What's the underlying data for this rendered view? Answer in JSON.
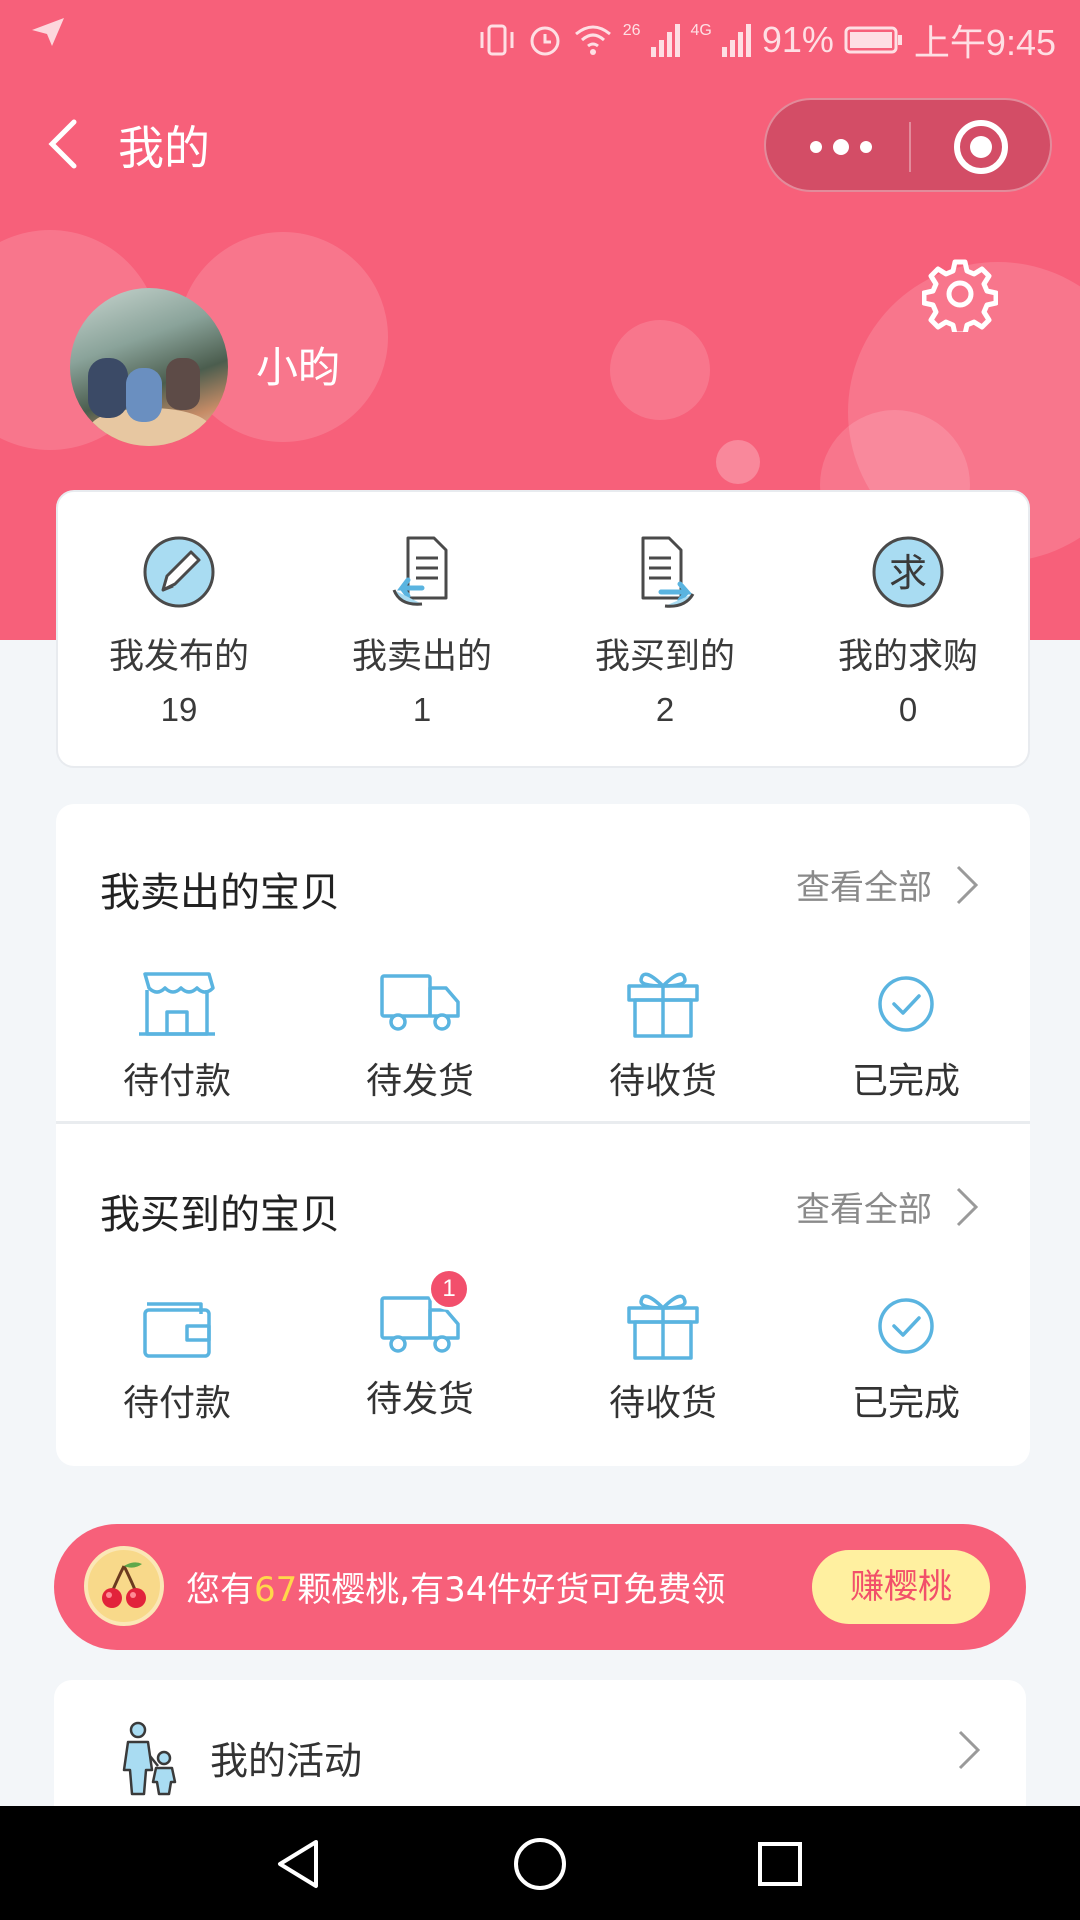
{
  "status_bar": {
    "battery": "91%",
    "time": "上午9:45",
    "net1": "26",
    "net2": "4G"
  },
  "nav": {
    "title": "我的"
  },
  "profile": {
    "username": "小昀"
  },
  "stats": [
    {
      "label": "我发布的",
      "value": "19",
      "icon": "pencil-icon"
    },
    {
      "label": "我卖出的",
      "value": "1",
      "icon": "document-return-icon"
    },
    {
      "label": "我买到的",
      "value": "2",
      "icon": "document-forward-icon"
    },
    {
      "label": "我的求购",
      "value": "0",
      "icon": "qiu-badge-icon",
      "icon_text": "求"
    }
  ],
  "sold": {
    "title": "我卖出的宝贝",
    "view_all": "查看全部",
    "items": [
      {
        "label": "待付款",
        "icon": "storefront-icon"
      },
      {
        "label": "待发货",
        "icon": "truck-icon"
      },
      {
        "label": "待收货",
        "icon": "gift-icon"
      },
      {
        "label": "已完成",
        "icon": "check-circle-icon"
      }
    ]
  },
  "bought": {
    "title": "我买到的宝贝",
    "view_all": "查看全部",
    "items": [
      {
        "label": "待付款",
        "icon": "wallet-icon"
      },
      {
        "label": "待发货",
        "icon": "truck-icon",
        "badge": "1"
      },
      {
        "label": "待收货",
        "icon": "gift-icon"
      },
      {
        "label": "已完成",
        "icon": "check-circle-icon"
      }
    ]
  },
  "banner": {
    "prefix": "您有",
    "count": "67",
    "suffix": "颗樱桃,有34件好货可免费领",
    "button": "赚樱桃"
  },
  "activity": {
    "label": "我的活动"
  },
  "colors": {
    "brand_pink": "#f7607a",
    "icon_blue": "#5ab4e0",
    "highlight_yellow": "#ffd84a",
    "badge_red": "#f24f6c"
  }
}
